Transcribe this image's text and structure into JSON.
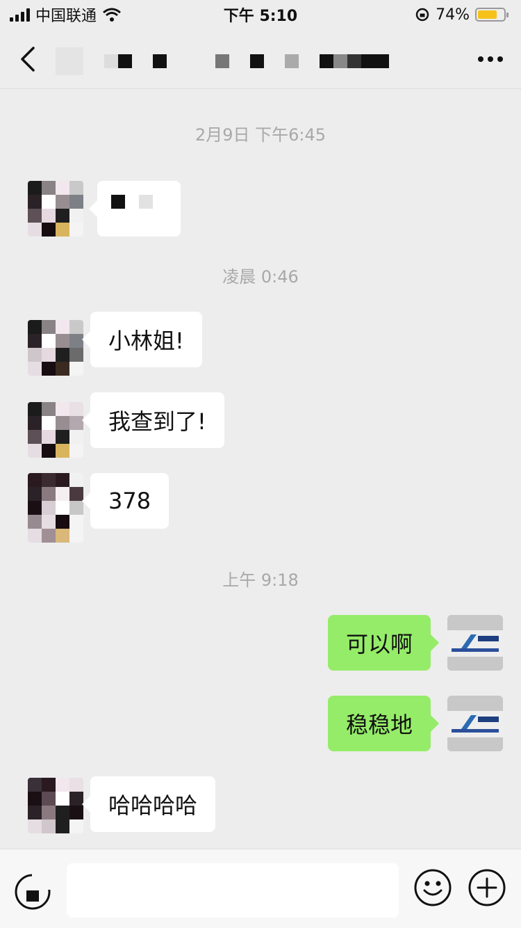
{
  "status_bar": {
    "carrier": "中国联通",
    "time": "下午 5:10",
    "battery_percent": "74%",
    "battery_level": 0.74,
    "battery_color": "#f6c21a"
  },
  "nav": {
    "back_icon": "chevron-left-icon",
    "title_redacted": true,
    "more_icon": "more-dots-icon"
  },
  "messages": [
    {
      "type": "time",
      "text": "2月9日 下午6:45"
    },
    {
      "type": "msg",
      "side": "left",
      "text": "",
      "redacted": true
    },
    {
      "type": "time",
      "text": "凌晨 0:46"
    },
    {
      "type": "msg",
      "side": "left",
      "text": "小林姐!"
    },
    {
      "type": "msg",
      "side": "left",
      "text": "我查到了!"
    },
    {
      "type": "msg",
      "side": "left",
      "text": "378"
    },
    {
      "type": "time",
      "text": "上午 9:18"
    },
    {
      "type": "msg",
      "side": "right",
      "text": "可以啊"
    },
    {
      "type": "msg",
      "side": "right",
      "text": "稳稳地"
    },
    {
      "type": "msg",
      "side": "left",
      "text": "哈哈哈哈"
    }
  ],
  "colors": {
    "background": "#ededed",
    "bubble_left": "#ffffff",
    "bubble_right": "#95ec69",
    "timestamp": "#a8a8a8"
  },
  "input_bar": {
    "voice_icon": "voice-icon",
    "input_value": "",
    "emoji_icon": "emoji-icon",
    "plus_icon": "plus-circle-icon"
  }
}
